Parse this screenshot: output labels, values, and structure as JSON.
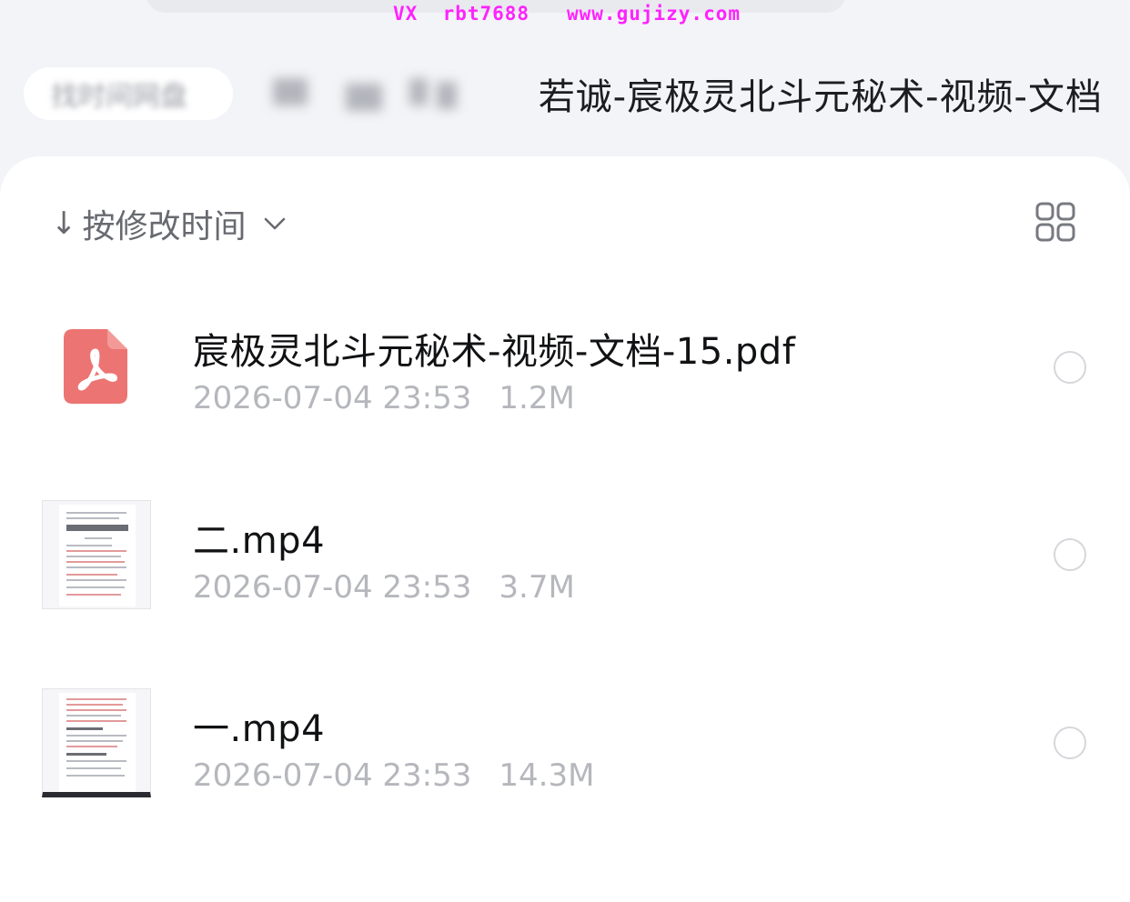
{
  "watermark": "VX  rbt7688   www.gujizy.com",
  "breadcrumb": {
    "first_label": "找时间网盘",
    "current": "若诚-宸极灵北斗元秘术-视频-文档"
  },
  "toolbar": {
    "sort_arrow": "↓",
    "sort_label": "按修改时间",
    "sort_dropdown_icon": "chevron-down-icon",
    "view_toggle_icon": "grid-view-icon"
  },
  "files": [
    {
      "name": "宸极灵北斗元秘术-视频-文档-15.pdf",
      "date": "2026-07-04 23:53",
      "size": "1.2M",
      "icon": "pdf-icon"
    },
    {
      "name": "二.mp4",
      "date": "2026-07-04 23:53",
      "size": "3.7M",
      "icon": "video-thumbnail"
    },
    {
      "name": "一.mp4",
      "date": "2026-07-04 23:53",
      "size": "14.3M",
      "icon": "video-thumbnail"
    }
  ],
  "colors": {
    "pdf": "#ec7472",
    "watermark": "#ff22ff",
    "meta_text": "#b5b7bc"
  }
}
